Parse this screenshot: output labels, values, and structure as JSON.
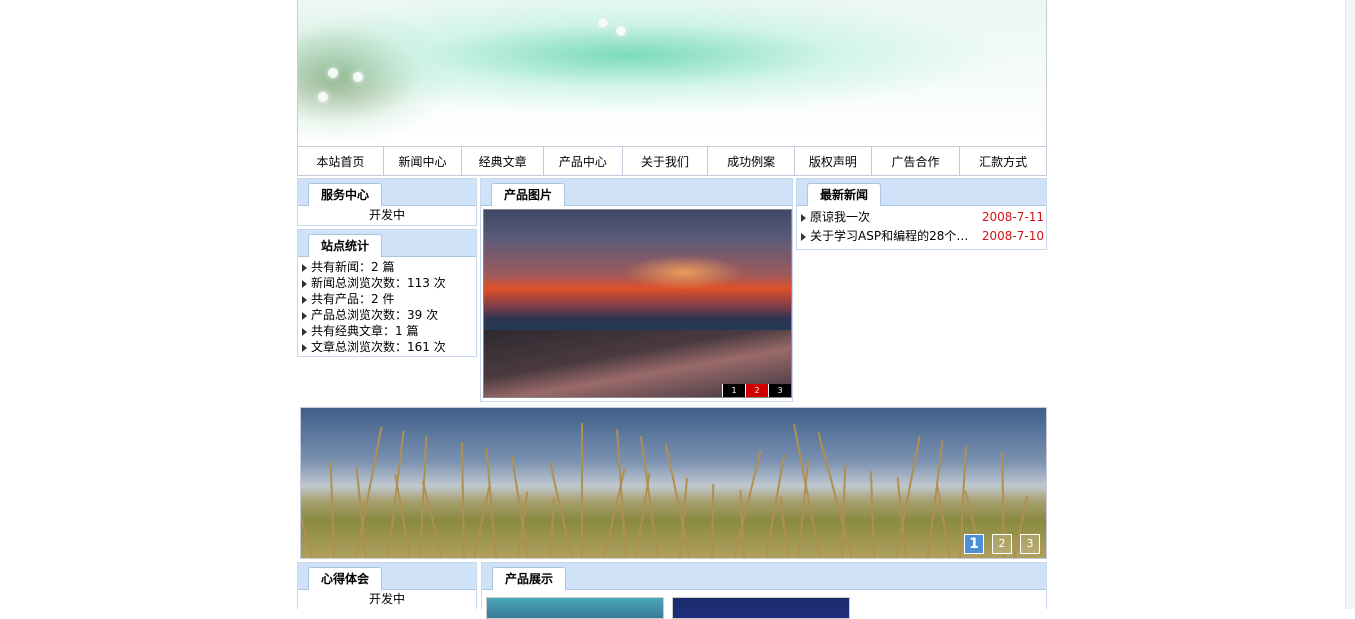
{
  "nav": [
    "本站首页",
    "新闻中心",
    "经典文章",
    "产品中心",
    "关于我们",
    "成功例案",
    "版权声明",
    "广告合作",
    "汇款方式"
  ],
  "service": {
    "title": "服务中心",
    "body": "开发中"
  },
  "stats": {
    "title": "站点统计",
    "items": [
      "共有新闻：2 篇",
      "新闻总浏览次数：113 次",
      "共有产品：2 件",
      "产品总浏览次数：39 次",
      "共有经典文章：1 篇",
      "文章总浏览次数：161 次"
    ]
  },
  "product_pics": {
    "title": "产品图片",
    "pages": [
      "1",
      "2",
      "3"
    ],
    "active_page": "2"
  },
  "news": {
    "title": "最新新闻",
    "items": [
      {
        "title": "原谅我一次",
        "date": "2008-7-11"
      },
      {
        "title": "关于学习ASP和编程的28个…",
        "date": "2008-7-10"
      }
    ]
  },
  "slideshow": {
    "pages": [
      "1",
      "2",
      "3"
    ],
    "active_page": "1"
  },
  "experience": {
    "title": "心得体会",
    "body": "开发中"
  },
  "showcase": {
    "title": "产品展示"
  },
  "colors": {
    "accent": "#cfe2f7",
    "date": "#d41418"
  }
}
